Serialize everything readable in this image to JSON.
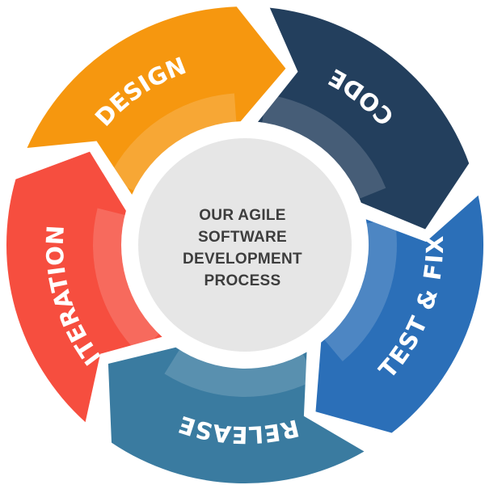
{
  "title_lines": [
    "OUR AGILE",
    "SOFTWARE",
    "DEVELOPMENT",
    "PROCESS"
  ],
  "stages": [
    {
      "label": "ITERATION",
      "color": "#f64e3f"
    },
    {
      "label": "DESIGN",
      "color": "#f6970f"
    },
    {
      "label": "CODE",
      "color": "#233f5d"
    },
    {
      "label": "TEST & FIX",
      "color": "#2b6fb8"
    },
    {
      "label": "RELEASE",
      "color": "#3a7ba0"
    }
  ],
  "center_color": "#e6e6e6",
  "ring_color": "#ffffff"
}
